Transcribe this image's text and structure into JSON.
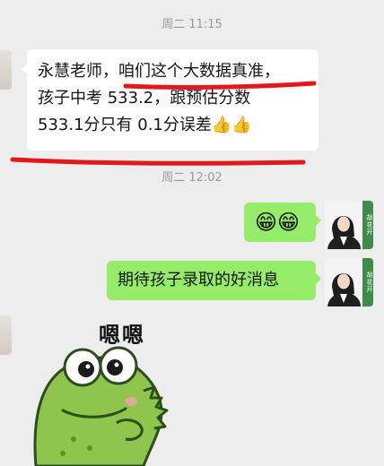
{
  "timestamps": [
    "周二 11:15",
    "周二 12:02"
  ],
  "incoming_message": {
    "line1_prefix": "永慧老师，",
    "line1_highlight": "咱们这个大数据真准",
    "line1_suffix": "，",
    "line2": "孩子中考 533.2，跟预估分数",
    "line3_text": "533.1分只有 0.1分误差",
    "line3_emojis": "👍👍"
  },
  "outgoing_emoji_message": "😁😁",
  "outgoing_text_message": "期待孩子录取的好消息",
  "avatar_strip_label": "胡花开",
  "sticker_caption": "嗯嗯",
  "colors": {
    "background": "#ededed",
    "outgoing_bubble": "#95ec69",
    "incoming_bubble": "#ffffff",
    "annotation_red": "#e01a1a",
    "strip_green": "#3f8c4a"
  }
}
